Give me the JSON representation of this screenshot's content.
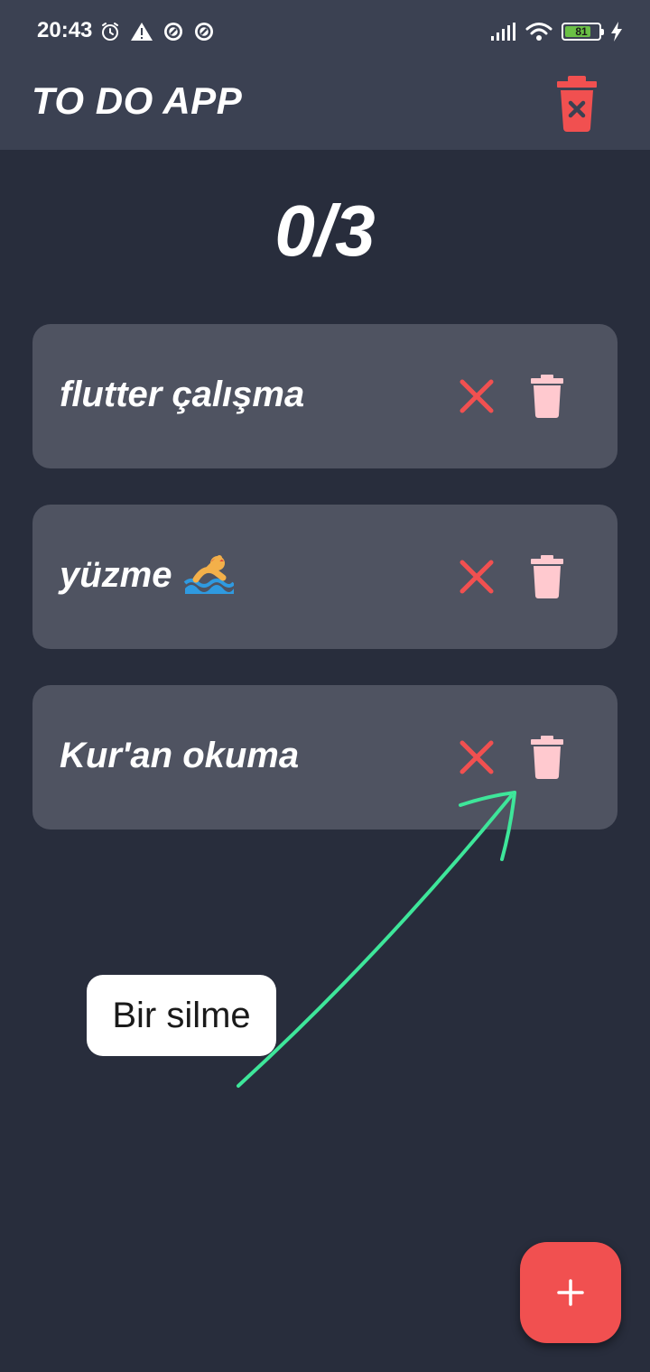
{
  "status_bar": {
    "time": "20:43",
    "battery_percent": "81",
    "battery_level": 0.81,
    "left_icons": [
      "alarm-icon",
      "warning-icon",
      "app-notification-icon",
      "app-notification-icon"
    ],
    "right_icons": [
      "signal-icon",
      "wifi-icon",
      "battery-icon",
      "charging-icon"
    ]
  },
  "app_bar": {
    "title": "TO DO APP",
    "action_icon": "delete-all-icon"
  },
  "counter": {
    "text": "0/3"
  },
  "todos": [
    {
      "title": "flutter çalışma",
      "emoji": ""
    },
    {
      "title": "yüzme",
      "emoji": "swimmer"
    },
    {
      "title": "Kur'an okuma",
      "emoji": ""
    }
  ],
  "annotation": {
    "label": "Bir silme"
  },
  "fab": {
    "icon": "plus-icon"
  },
  "colors": {
    "background": "#282d3c",
    "app_bar": "#3b4152",
    "card": "#4f5361",
    "accent_red": "#f15050",
    "trash_pink": "#ffc9cf",
    "arrow_green": "#3ee69a"
  }
}
